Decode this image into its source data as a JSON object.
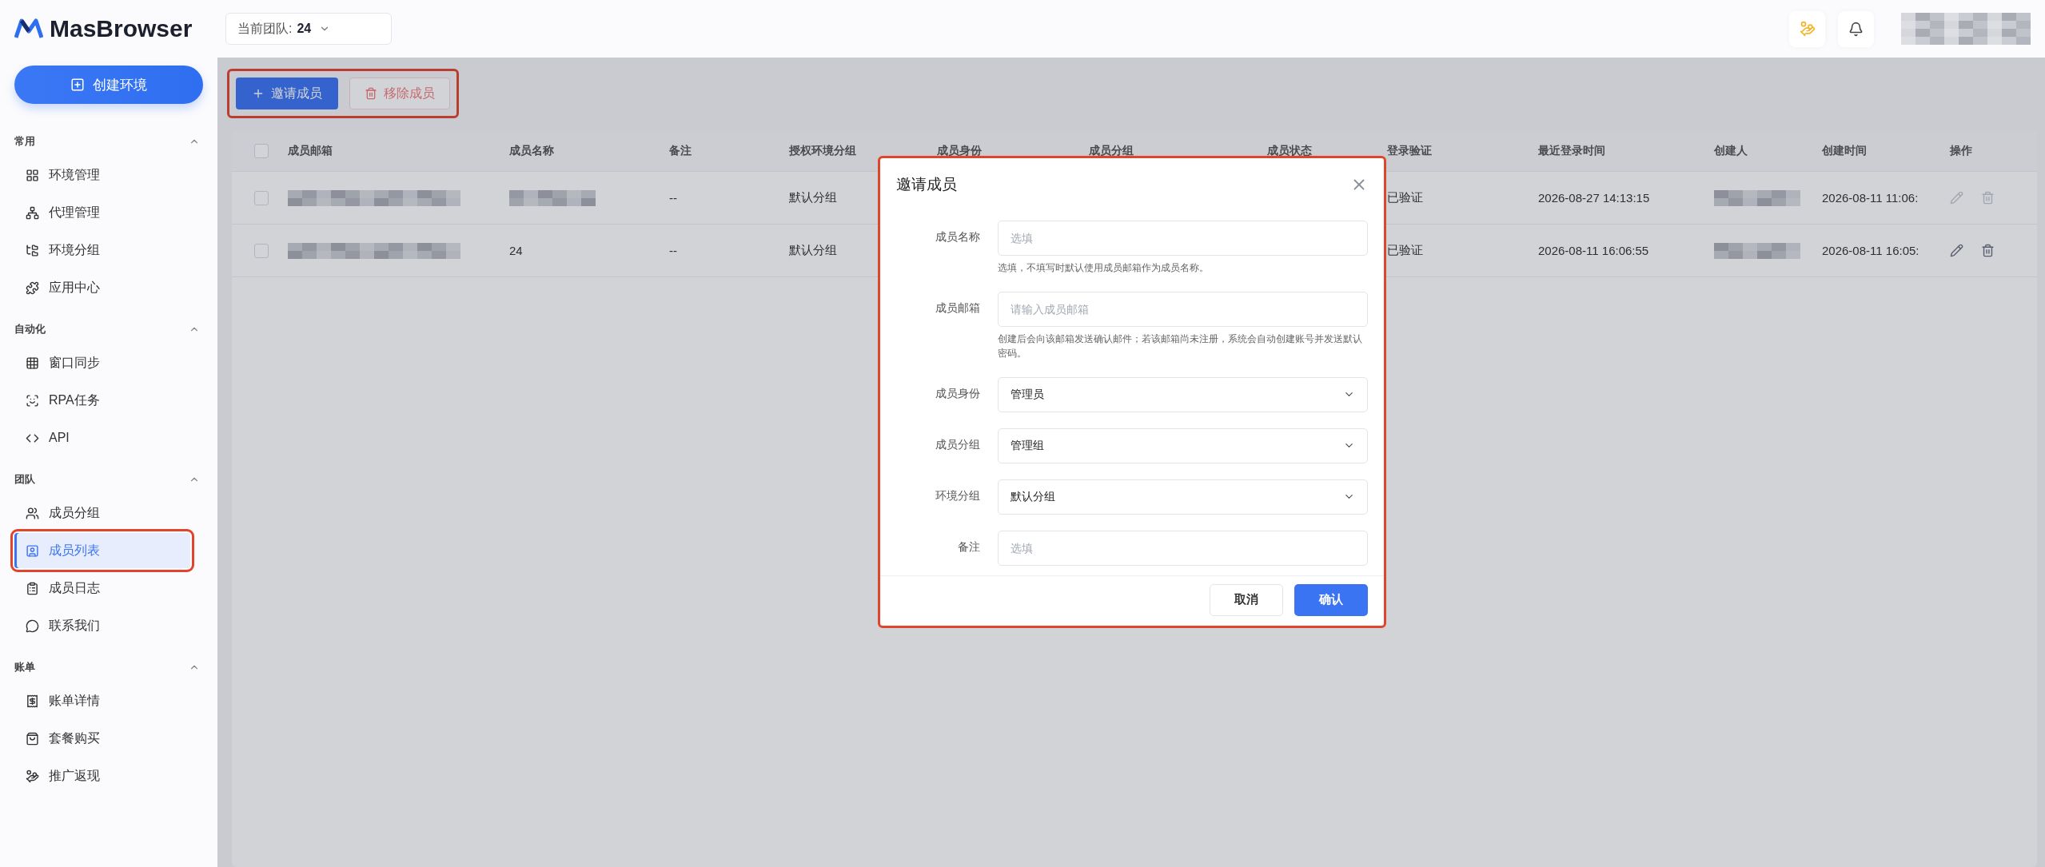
{
  "header": {
    "logo": "MasBrowser",
    "team_label": "当前团队:",
    "team_value": "24"
  },
  "sidebar": {
    "create_button": "创建环境",
    "sections": [
      {
        "title": "常用",
        "expanded": true,
        "items": [
          {
            "label": "环境管理",
            "selected": false
          },
          {
            "label": "代理管理",
            "selected": false
          },
          {
            "label": "环境分组",
            "selected": false
          },
          {
            "label": "应用中心",
            "selected": false
          }
        ]
      },
      {
        "title": "自动化",
        "expanded": true,
        "items": [
          {
            "label": "窗口同步",
            "selected": false
          },
          {
            "label": "RPA任务",
            "selected": false
          },
          {
            "label": "API",
            "selected": false
          }
        ]
      },
      {
        "title": "团队",
        "expanded": true,
        "items": [
          {
            "label": "成员分组",
            "selected": false
          },
          {
            "label": "成员列表",
            "selected": true
          },
          {
            "label": "成员日志",
            "selected": false
          },
          {
            "label": "联系我们",
            "selected": false
          }
        ]
      },
      {
        "title": "账单",
        "expanded": true,
        "items": [
          {
            "label": "账单详情",
            "selected": false
          },
          {
            "label": "套餐购买",
            "selected": false
          },
          {
            "label": "推广返现",
            "selected": false
          }
        ]
      }
    ]
  },
  "toolbar": {
    "invite_button": "邀请成员",
    "remove_button": "移除成员"
  },
  "table": {
    "header_checked": false,
    "columns": [
      "成员邮箱",
      "成员名称",
      "备注",
      "授权环境分组",
      "成员身份",
      "成员分组",
      "成员状态",
      "登录验证",
      "最近登录时间",
      "创建人",
      "创建时间",
      "操作"
    ],
    "rows": [
      {
        "checked": false,
        "actions_disabled": true,
        "cells": [
          {
            "kind": "redacted"
          },
          {
            "kind": "redacted"
          },
          "--",
          "默认分组",
          null,
          null,
          null,
          "已验证",
          "2026-08-27 14:13:15",
          {
            "kind": "redacted"
          },
          "2026-08-11 11:06:"
        ]
      },
      {
        "checked": false,
        "actions_disabled": false,
        "cells": [
          {
            "kind": "redacted"
          },
          "24",
          "--",
          "默认分组",
          null,
          null,
          null,
          "已验证",
          "2026-08-11 16:06:55",
          {
            "kind": "redacted"
          },
          "2026-08-11 16:05:"
        ]
      }
    ]
  },
  "dialog": {
    "title": "邀请成员",
    "fields": [
      {
        "kind": "input",
        "label": "成员名称",
        "placeholder": "选填",
        "hint": "选填，不填写时默认使用成员邮箱作为成员名称。"
      },
      {
        "kind": "input",
        "label": "成员邮箱",
        "placeholder": "请输入成员邮箱",
        "hint": "创建后会向该邮箱发送确认邮件；若该邮箱尚未注册，系统会自动创建账号并发送默认密码。"
      },
      {
        "kind": "select",
        "label": "成员身份",
        "value": "管理员"
      },
      {
        "kind": "select",
        "label": "成员分组",
        "value": "管理组"
      },
      {
        "kind": "select",
        "label": "环境分组",
        "value": "默认分组"
      },
      {
        "kind": "input",
        "label": "备注",
        "placeholder": "选填"
      }
    ],
    "cancel_button": "取消",
    "confirm_button": "确认"
  }
}
